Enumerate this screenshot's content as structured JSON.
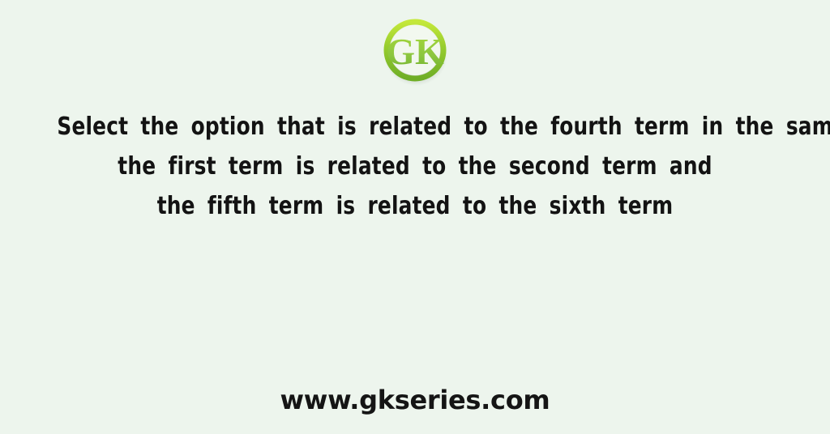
{
  "page": {
    "background_color": "#edf5ed",
    "text_color": "#131313"
  },
  "logo": {
    "name": "gk-logo",
    "text": "GK",
    "ring_color_light": "#b6e02a",
    "ring_color_dark": "#7ab82a",
    "letter_color": "#8dc63f",
    "shadow_color": "#9aa79a"
  },
  "question": {
    "lines": [
      "Select the option that is related to the fourth term in the same way as",
      "the first term is related to the second term and",
      "the fifth term is related to the sixth term"
    ]
  },
  "footer": {
    "url": "www.gkseries.com"
  }
}
